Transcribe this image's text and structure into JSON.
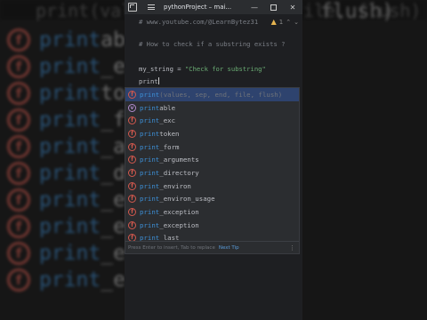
{
  "background": {
    "top_text": "print(values, sep, end, file, flush)",
    "right_fragment": "flush)",
    "items": [
      {
        "label": "print",
        "rest": "able"
      },
      {
        "label": "print",
        "rest": "_exc"
      },
      {
        "label": "print",
        "rest": "token"
      },
      {
        "label": "print",
        "rest": "_form"
      },
      {
        "label": "print",
        "rest": "_argu"
      },
      {
        "label": "print",
        "rest": "_direc"
      },
      {
        "label": "print",
        "rest": "_envi"
      },
      {
        "label": "print",
        "rest": "_envi"
      },
      {
        "label": "print",
        "rest": "_exce"
      },
      {
        "label": "print",
        "rest": "_exce"
      }
    ]
  },
  "titlebar": {
    "title": "pythonProject – mai...",
    "min": "—",
    "close": "✕"
  },
  "editor": {
    "line1": "# www.youtube.com/@LearnBytez31",
    "inspect_count": "1",
    "line2": "# How to check if a substring exists ?",
    "line3_var": "my_string = ",
    "line3_str": "\"Check for substring\"",
    "line4": "print"
  },
  "completion": {
    "items": [
      {
        "prefix": "print",
        "rest": "",
        "params": "(values, sep, end, file, flush)",
        "icon": "f",
        "kind": "function"
      },
      {
        "prefix": "print",
        "rest": "able",
        "params": "",
        "icon": "v",
        "kind": "variable"
      },
      {
        "prefix": "print",
        "rest": "_exc",
        "params": "",
        "icon": "f",
        "kind": "function"
      },
      {
        "prefix": "print",
        "rest": "token",
        "params": "",
        "icon": "f",
        "kind": "function"
      },
      {
        "prefix": "print",
        "rest": "_form",
        "params": "",
        "icon": "f",
        "kind": "function"
      },
      {
        "prefix": "print",
        "rest": "_arguments",
        "params": "",
        "icon": "f",
        "kind": "function"
      },
      {
        "prefix": "print",
        "rest": "_directory",
        "params": "",
        "icon": "f",
        "kind": "function"
      },
      {
        "prefix": "print",
        "rest": "_environ",
        "params": "",
        "icon": "f",
        "kind": "function"
      },
      {
        "prefix": "print",
        "rest": "_environ_usage",
        "params": "",
        "icon": "f",
        "kind": "function"
      },
      {
        "prefix": "print",
        "rest": "_exception",
        "params": "",
        "icon": "f",
        "kind": "function"
      },
      {
        "prefix": "print",
        "rest": "_exception",
        "params": "",
        "icon": "f",
        "kind": "function"
      },
      {
        "prefix": "print",
        "rest": "_last",
        "params": "",
        "icon": "f",
        "kind": "function"
      }
    ],
    "footer_text": "Press Enter to insert, Tab to replace",
    "footer_tip": "Next Tip",
    "footer_more": "⋮"
  },
  "colors": {
    "function_icon": "#d2584d",
    "variable_icon": "#b08acb",
    "match_highlight": "#3d8fd6",
    "selection": "#2e436e"
  }
}
